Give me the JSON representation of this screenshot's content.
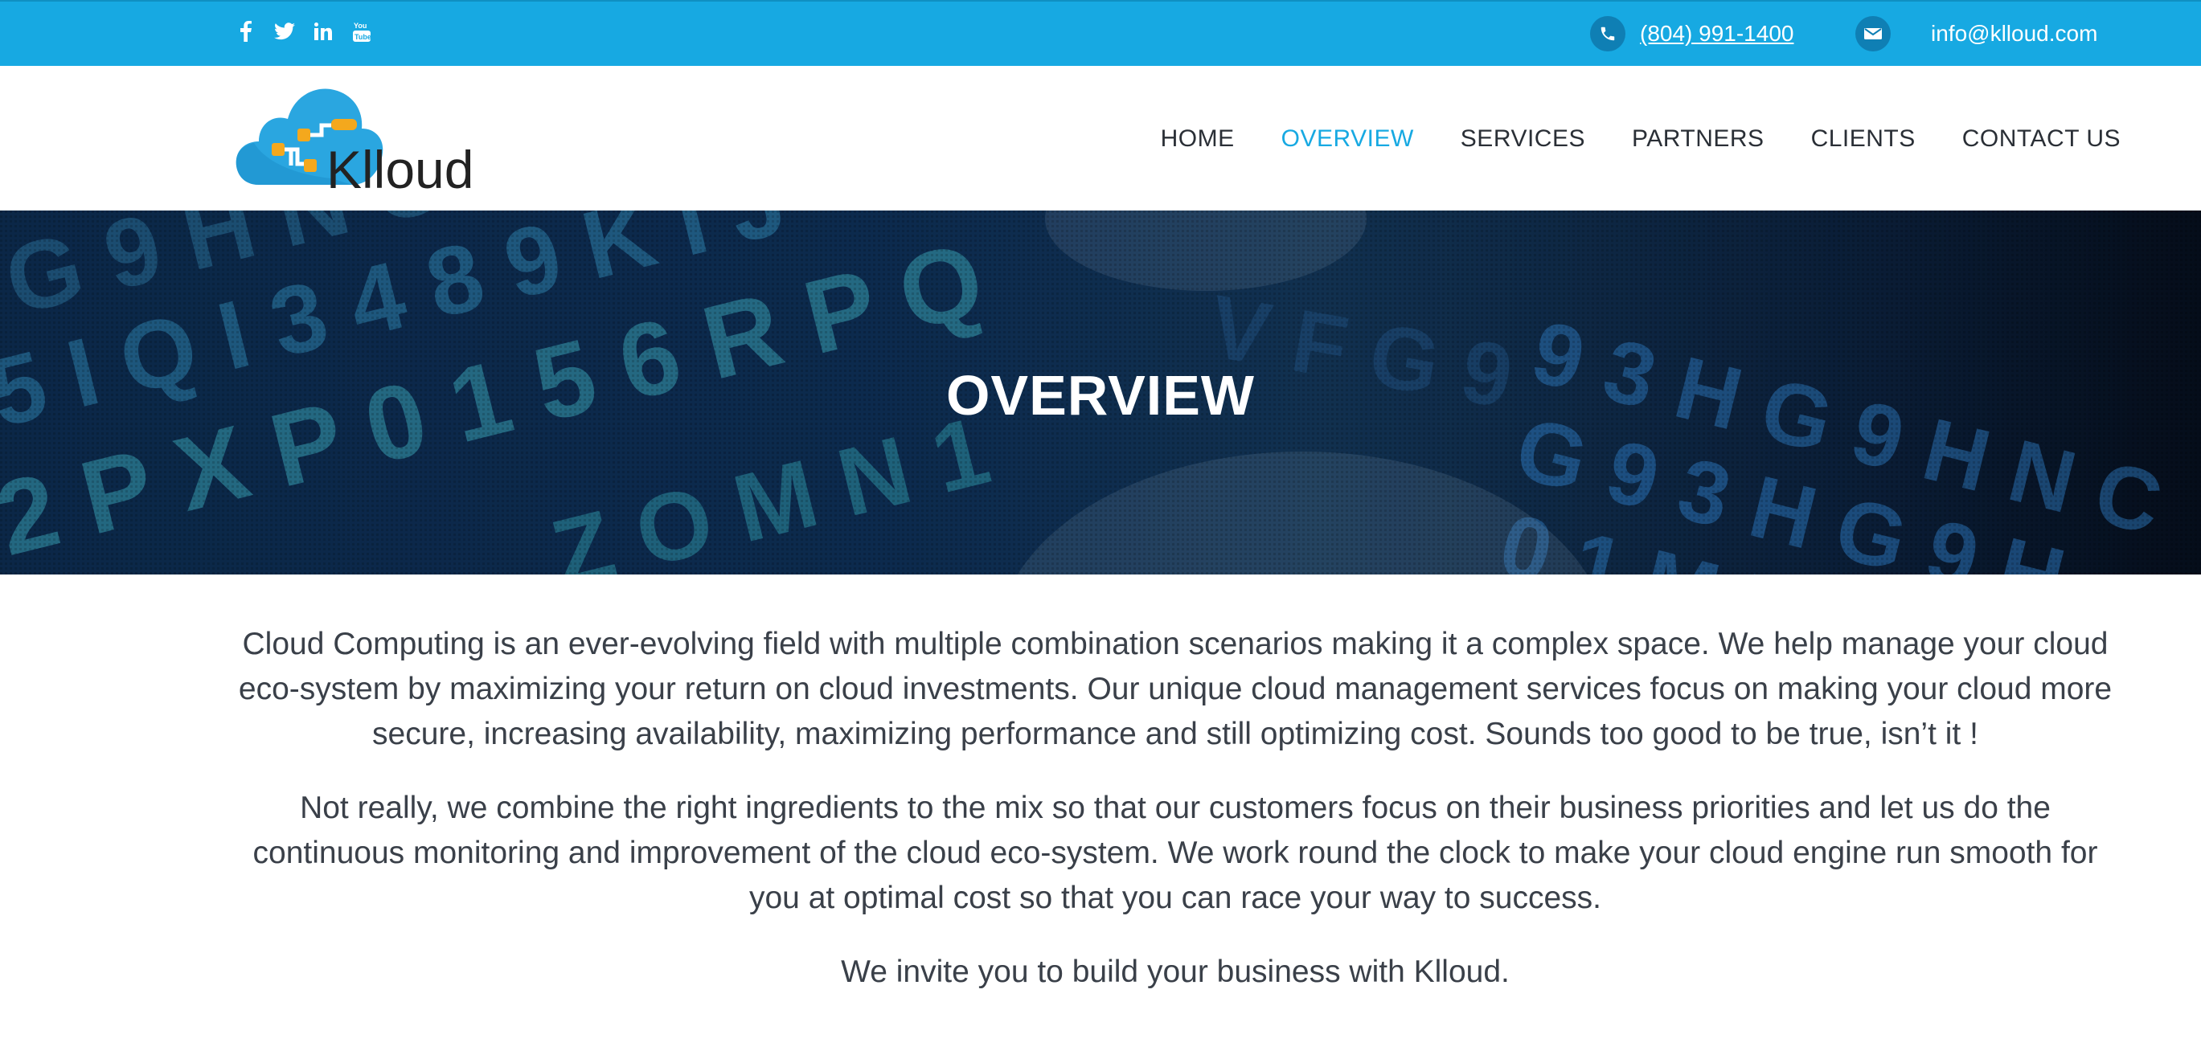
{
  "topbar": {
    "social_icons": [
      "facebook-icon",
      "twitter-icon",
      "linkedin-icon",
      "youtube-icon"
    ],
    "phone_icon": "phone-icon",
    "phone": "(804) 991-1400",
    "email_icon": "envelope-icon",
    "email": "info@klloud.com",
    "background_color": "#17a9e2"
  },
  "header": {
    "logo_text": "Klloud",
    "nav": {
      "home": "HOME",
      "overview": "OVERVIEW",
      "services": "SERVICES",
      "partners": "PARTNERS",
      "clients": "CLIENTS",
      "contact": "CONTACT US"
    },
    "active_nav": "OVERVIEW",
    "accent_color": "#17a9e2"
  },
  "hero": {
    "title": "OVERVIEW"
  },
  "content": {
    "paragraph1": "Cloud Computing is an ever-evolving field with multiple combination scenarios making it a complex space. We help manage your cloud eco-system by maximizing your return on cloud investments. Our unique cloud management services focus on making your cloud more secure, increasing availability, maximizing performance and still optimizing cost. Sounds too good to be true, isn’t it !",
    "paragraph2": "Not really, we combine the right ingredients to the mix so that our customers focus on their business priorities and let us do the continuous monitoring and improvement of the cloud eco-system. We work round the clock to make your cloud engine run smooth for you at optimal cost so that you can race your way to success.",
    "paragraph3": "We invite you to build your business with Klloud."
  }
}
